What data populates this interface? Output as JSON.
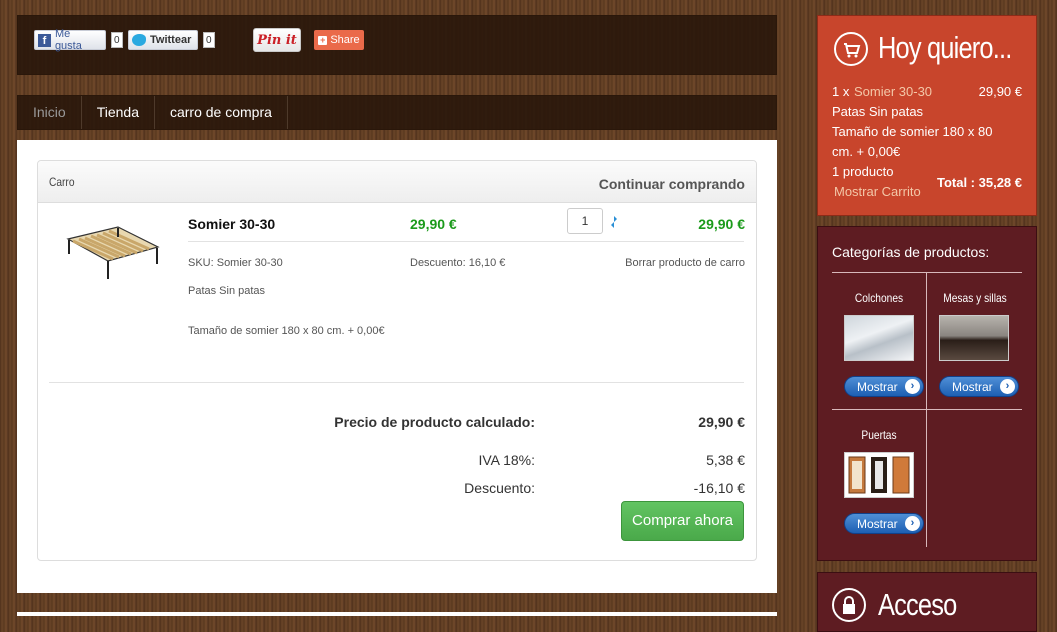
{
  "social": {
    "fb_label": "Me gusta",
    "fb_count": "0",
    "tw_label": "Twittear",
    "tw_count": "0",
    "pin_label": "Pin it",
    "share_label": "Share"
  },
  "nav": {
    "items": [
      "Inicio",
      "Tienda",
      "carro de compra"
    ]
  },
  "cart": {
    "header_title": "Carro",
    "continue_label": "Continuar comprando",
    "product": {
      "name": "Somier 30-30",
      "price": "29,90 €",
      "quantity": "1",
      "total": "29,90 €",
      "sku": "SKU: Somier 30-30",
      "discount": "Descuento: 16,10 €",
      "remove": "Borrar producto de carro",
      "option1": "Patas Sin patas",
      "option2": "Tamaño de somier 180 x 80 cm. + 0,00€"
    },
    "summary": {
      "calc_label": "Precio de producto calculado:",
      "calc_value": "29,90 €",
      "iva_label": "IVA 18%:",
      "iva_value": "5,38 €",
      "desc_label": "Descuento:",
      "desc_value": "-16,10 €"
    },
    "buy_label": "Comprar ahora"
  },
  "mini_cart": {
    "title": "Hoy quiero...",
    "qty_prefix": "1 x ",
    "item_name": "Somier 30-30",
    "item_price": "29,90 €",
    "line1": "Patas Sin patas",
    "line2": "Tamaño de somier 180 x 80",
    "line3": "cm. + 0,00€",
    "count": "1 producto",
    "show_cart": "Mostrar Carrito",
    "total": "Total : 35,28 €"
  },
  "categories": {
    "title": "Categorías de productos:",
    "items": [
      {
        "name": "Colchones",
        "button": "Mostrar"
      },
      {
        "name": "Mesas y sillas",
        "button": "Mostrar"
      },
      {
        "name": "Puertas",
        "button": "Mostrar"
      }
    ]
  },
  "access": {
    "title": "Acceso"
  },
  "colors": {
    "accent_orange": "#c8452c",
    "sidebar_maroon": "#5e1c22",
    "price_green": "#1a9a1a",
    "buy_green": "#5cb85c"
  }
}
